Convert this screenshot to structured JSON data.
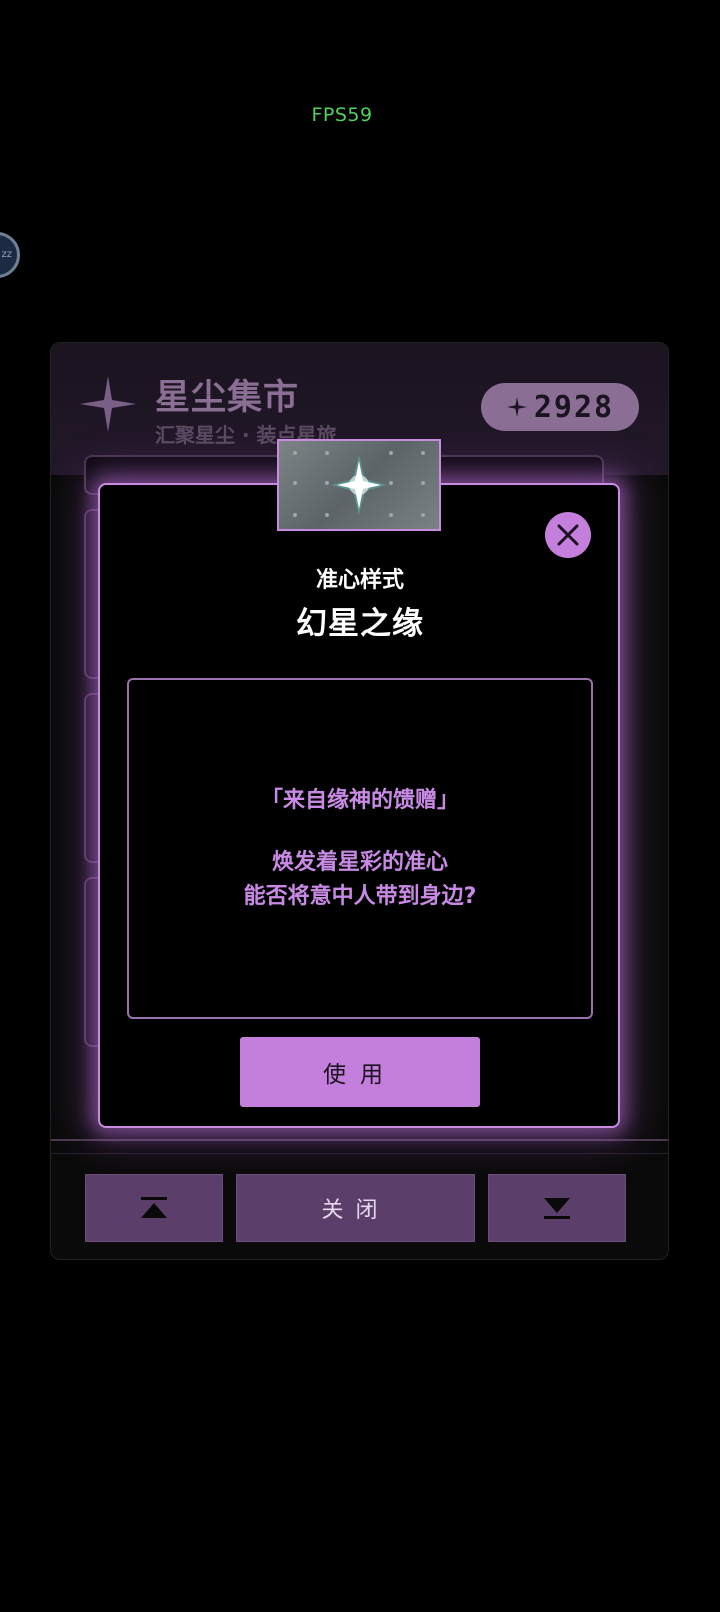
{
  "fps": "FPS59",
  "bubble": "zz",
  "shop": {
    "title": "星尘集市",
    "subtitle": "汇聚星尘 · 装点星旅",
    "currency": "2928"
  },
  "footer": {
    "top_label": "",
    "close_label": "关闭",
    "bottom_label": ""
  },
  "item": {
    "category": "准心样式",
    "name": "幻星之缘",
    "desc_quote": "「来自缘神的馈赠」",
    "desc_line1": "焕发着星彩的准心",
    "desc_line2": "能否将意中人带到身边?",
    "use_label": "使用"
  },
  "colors": {
    "accent": "#c47fdc",
    "panel": "#5b3f6a",
    "muted": "#8a6e94"
  }
}
